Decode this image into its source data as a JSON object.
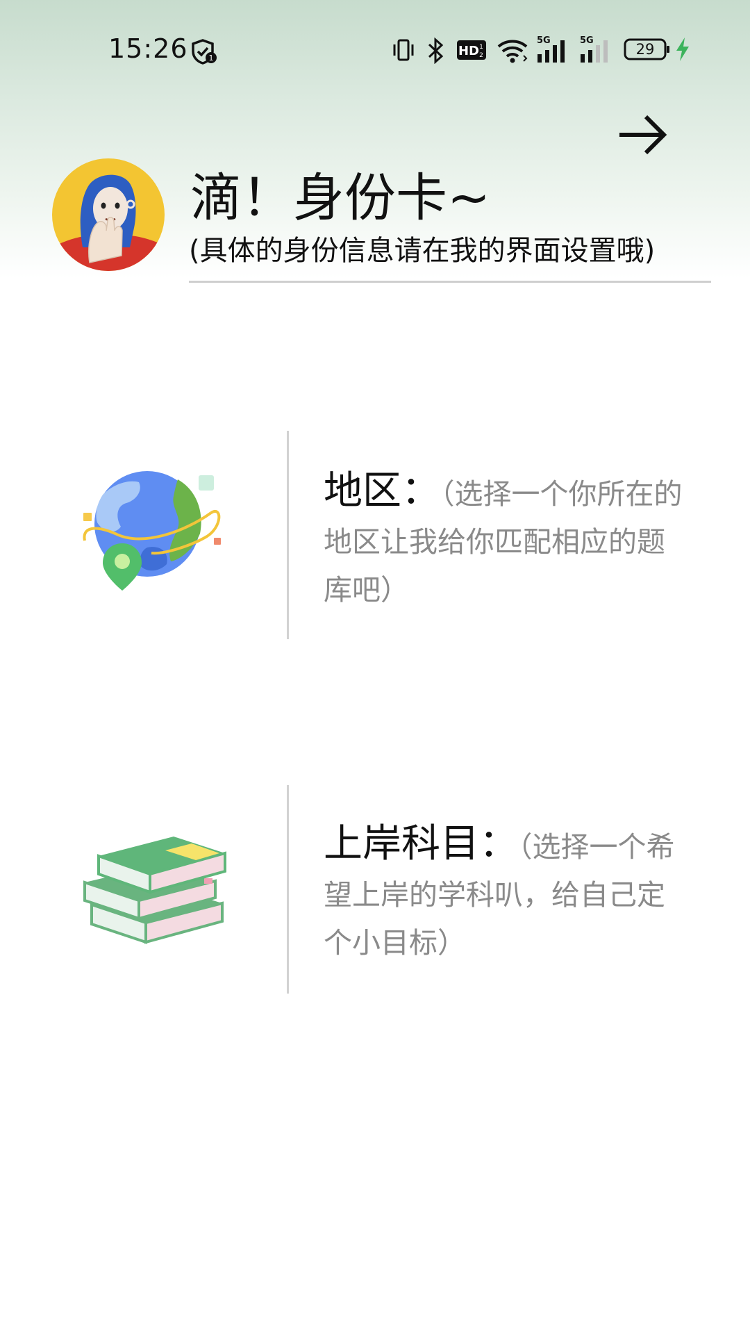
{
  "status_bar": {
    "time": "15:26",
    "battery": "29",
    "network_1": "5G",
    "network_2": "5G",
    "hd_badge": "HD",
    "icons": [
      "shield-badge-icon",
      "vibrate-icon",
      "bluetooth-icon",
      "hd-voice-icon",
      "wifi-icon",
      "signal-icon",
      "signal-icon",
      "battery-icon",
      "charging-icon"
    ]
  },
  "header": {
    "title": "滴！身份卡~",
    "subtitle": "(具体的身份信息请在我的界面设置哦)",
    "next_icon": "arrow-right-icon"
  },
  "cards": [
    {
      "title": "地区：",
      "description": "（选择一个你所在的地区让我给你匹配相应的题库吧）",
      "icon": "globe-location-icon"
    },
    {
      "title": "上岸科目：",
      "description": "（选择一个希望上岸的学科叭，给自己定个小目标）",
      "icon": "books-icon"
    }
  ],
  "colors": {
    "header_gradient_top": "#c7dccd",
    "accent_green": "#5fb67a",
    "charging_green": "#3cb35c",
    "description_gray": "#8a8a8a"
  }
}
